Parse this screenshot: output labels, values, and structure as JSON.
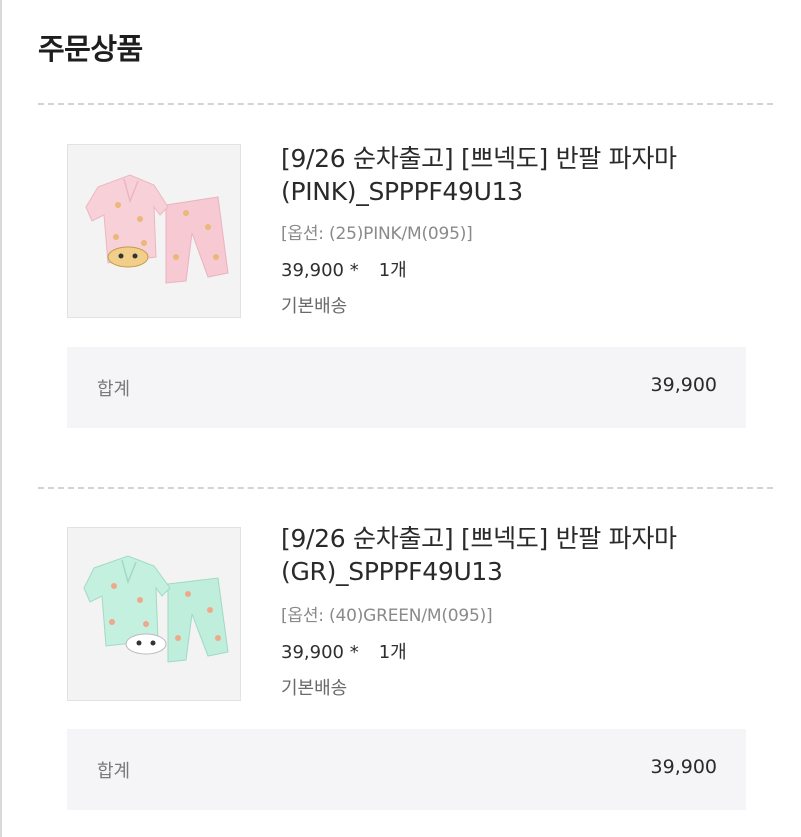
{
  "section": {
    "title": "주문상품"
  },
  "items": [
    {
      "name_line1": "[9/26 순차출고] [쁘넥도] 반팔 파자마",
      "name_line2": "(PINK)_SPPPF49U13",
      "option": "[옵션: (25)PINK/M(095)]",
      "price": "39,900 *",
      "quantity": "1개",
      "shipping": "기본배송",
      "total_label": "합계",
      "total_value": "39,900",
      "image_color": "#f6c9d3",
      "image_bg": "#f4f4f4",
      "icon": "pink-pajama-product-image"
    },
    {
      "name_line1": "[9/26 순차출고] [쁘넥도] 반팔 파자마",
      "name_line2": "(GR)_SPPPF49U13",
      "option": "[옵션: (40)GREEN/M(095)]",
      "price": "39,900 *",
      "quantity": "1개",
      "shipping": "기본배송",
      "total_label": "합계",
      "total_value": "39,900",
      "image_color": "#bfeedd",
      "image_bg": "#f4f4f4",
      "icon": "green-pajama-product-image"
    }
  ]
}
